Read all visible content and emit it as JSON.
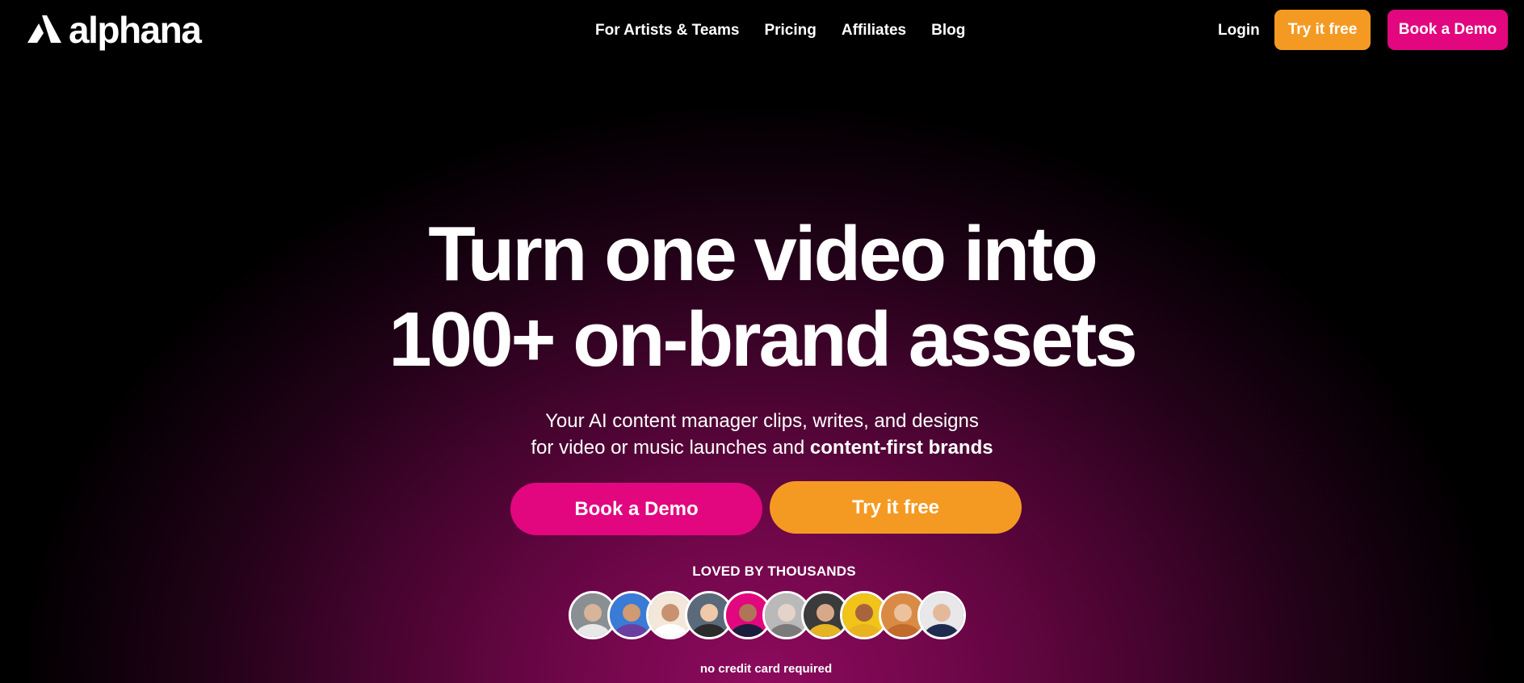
{
  "header": {
    "logo_text": "alphana",
    "nav": [
      "For Artists & Teams",
      "Pricing",
      "Affiliates",
      "Blog"
    ],
    "login": "Login",
    "try_label": "Try it free",
    "demo_label": "Book a Demo"
  },
  "hero": {
    "headline_line1": "Turn one video into",
    "headline_line2": "100+ on-brand assets",
    "sub_line1": "Your AI content manager clips, writes, and designs",
    "sub_line2_prefix": "for video or music launches and ",
    "sub_line2_bold": "content-first brands",
    "demo_button": "Book a Demo",
    "try_button": "Try it free",
    "loved": "LOVED BY THOUSANDS",
    "avatars": [
      {
        "bg": "#8a8f93",
        "face": "#d7b49a",
        "shirt": "#e8e8e8"
      },
      {
        "bg": "#3a7bd5",
        "face": "#d09a72",
        "shirt": "#6b3fa0"
      },
      {
        "bg": "#f3e7d9",
        "face": "#c89270",
        "shirt": "#ffffff"
      },
      {
        "bg": "#5a6a7a",
        "face": "#f0c9a8",
        "shirt": "#2b2b2b"
      },
      {
        "bg": "#e2077e",
        "face": "#b07458",
        "shirt": "#1c1c3c"
      },
      {
        "bg": "#b9b9b9",
        "face": "#e3d3c9",
        "shirt": "#7a7a7a"
      },
      {
        "bg": "#3b3b3b",
        "face": "#d8a988",
        "shirt": "#e4b423"
      },
      {
        "bg": "#f0c418",
        "face": "#a8643d",
        "shirt": "#e9b21f"
      },
      {
        "bg": "#d98b45",
        "face": "#ecc29c",
        "shirt": "#c26a2c"
      },
      {
        "bg": "#e8e8ea",
        "face": "#e3b99a",
        "shirt": "#1d2b4f"
      }
    ],
    "no_credit_card": "no credit card required"
  },
  "colors": {
    "accent_pink": "#e2077e",
    "accent_orange": "#f49a23",
    "background": "#000000"
  }
}
